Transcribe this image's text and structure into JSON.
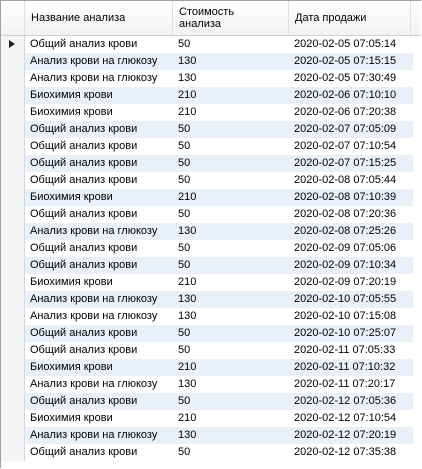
{
  "grid": {
    "columns": [
      {
        "label": "Название анализа"
      },
      {
        "label": "Стоимость\nанализа"
      },
      {
        "label": "Дата продажи"
      }
    ],
    "selected_row": 0,
    "rows": [
      {
        "name": "Общий анализ крови",
        "cost": "50",
        "date": "2020-02-05 07:05:14"
      },
      {
        "name": "Анализ крови на глюкозу",
        "cost": "130",
        "date": "2020-02-05 07:15:15"
      },
      {
        "name": "Анализ крови на глюкозу",
        "cost": "130",
        "date": "2020-02-05 07:30:49"
      },
      {
        "name": "Биохимия крови",
        "cost": "210",
        "date": "2020-02-06 07:10:10"
      },
      {
        "name": "Биохимия крови",
        "cost": "210",
        "date": "2020-02-06 07:20:38"
      },
      {
        "name": "Общий анализ крови",
        "cost": "50",
        "date": "2020-02-07 07:05:09"
      },
      {
        "name": "Общий анализ крови",
        "cost": "50",
        "date": "2020-02-07 07:10:54"
      },
      {
        "name": "Общий анализ крови",
        "cost": "50",
        "date": "2020-02-07 07:15:25"
      },
      {
        "name": "Общий анализ крови",
        "cost": "50",
        "date": "2020-02-08 07:05:44"
      },
      {
        "name": "Биохимия крови",
        "cost": "210",
        "date": "2020-02-08 07:10:39"
      },
      {
        "name": "Общий анализ крови",
        "cost": "50",
        "date": "2020-02-08 07:20:36"
      },
      {
        "name": "Анализ крови на глюкозу",
        "cost": "130",
        "date": "2020-02-08 07:25:26"
      },
      {
        "name": "Общий анализ крови",
        "cost": "50",
        "date": "2020-02-09 07:05:06"
      },
      {
        "name": "Общий анализ крови",
        "cost": "50",
        "date": "2020-02-09 07:10:34"
      },
      {
        "name": "Биохимия крови",
        "cost": "210",
        "date": "2020-02-09 07:20:19"
      },
      {
        "name": "Анализ крови на глюкозу",
        "cost": "130",
        "date": "2020-02-10 07:05:55"
      },
      {
        "name": "Анализ крови на глюкозу",
        "cost": "130",
        "date": "2020-02-10 07:15:08"
      },
      {
        "name": "Общий анализ крови",
        "cost": "50",
        "date": "2020-02-10 07:25:07"
      },
      {
        "name": "Общий анализ крови",
        "cost": "50",
        "date": "2020-02-11 07:05:33"
      },
      {
        "name": "Биохимия крови",
        "cost": "210",
        "date": "2020-02-11 07:10:32"
      },
      {
        "name": "Анализ крови на глюкозу",
        "cost": "130",
        "date": "2020-02-11 07:20:17"
      },
      {
        "name": "Общий анализ крови",
        "cost": "50",
        "date": "2020-02-12 07:05:36"
      },
      {
        "name": "Биохимия крови",
        "cost": "210",
        "date": "2020-02-12 07:10:54"
      },
      {
        "name": "Анализ крови на глюкозу",
        "cost": "130",
        "date": "2020-02-12 07:20:19"
      },
      {
        "name": "Общий анализ крови",
        "cost": "50",
        "date": "2020-02-12 07:35:38"
      }
    ]
  },
  "colors": {
    "row_alt": "#eaf0fa",
    "row_base": "#ffffff",
    "grid_border": "#a0a0a0",
    "selector_arrow": "#202020"
  },
  "icons": {
    "row_selector": "current-row-arrow-icon"
  }
}
